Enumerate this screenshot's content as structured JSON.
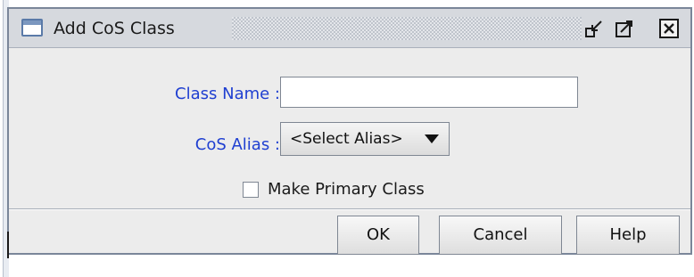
{
  "dialog": {
    "title": "Add CoS Class"
  },
  "form": {
    "class_name_label": "Class Name :",
    "class_name_value": "",
    "cos_alias_label": "CoS Alias :",
    "cos_alias_selected": "<Select Alias>",
    "make_primary_label": "Make Primary Class",
    "make_primary_checked": false
  },
  "buttons": {
    "ok": "OK",
    "cancel": "Cancel",
    "help": "Help"
  },
  "icons": {
    "window_icon": "window-icon",
    "iconify": "iconify-icon",
    "maximize": "maximize-icon",
    "close": "close-icon",
    "dropdown": "chevron-down-icon"
  },
  "colors": {
    "label_blue": "#1f3fd1",
    "dialog_bg": "#ececec",
    "title_bg": "#d6d9de"
  }
}
